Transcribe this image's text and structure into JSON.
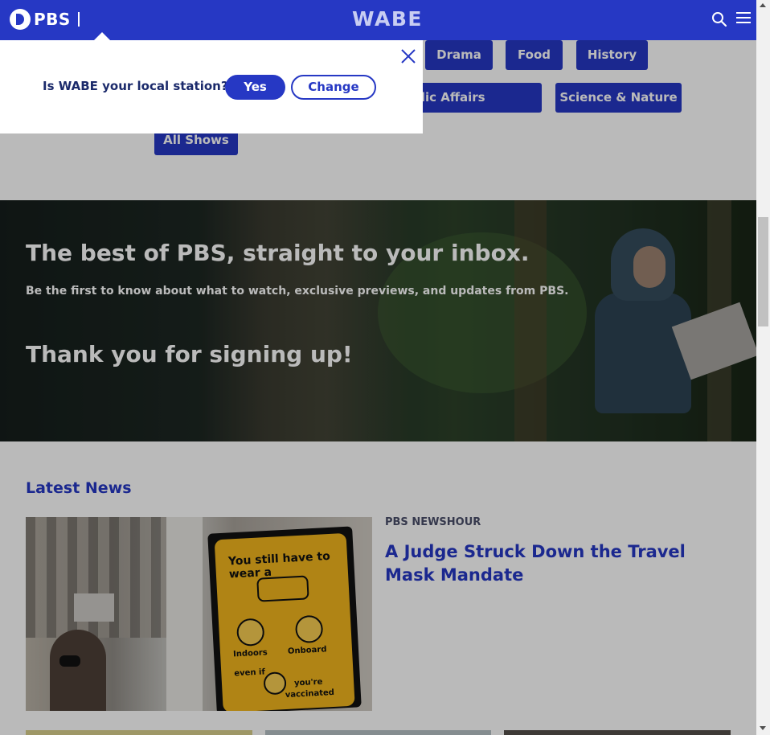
{
  "header": {
    "pbs_logo_text": "PBS",
    "station_logo_text": "WABE",
    "icons": [
      "search-icon",
      "menu-icon"
    ]
  },
  "genres": {
    "items": [
      {
        "label": "Drama"
      },
      {
        "label": "Food"
      },
      {
        "label": "History"
      },
      {
        "label": "News & Public Affairs"
      },
      {
        "label": "Science & Nature"
      },
      {
        "label": "All Shows"
      }
    ]
  },
  "newsletter": {
    "title": "The best of PBS, straight to your inbox.",
    "subtitle": "Be the first to know about what to watch, exclusive previews, and updates from PBS.",
    "confirmation": "Thank you for signing up!"
  },
  "latest_news": {
    "section_title": "Latest News",
    "featured": {
      "source": "PBS NEWSHOUR",
      "headline": "A Judge Struck Down the Travel Mask Mandate",
      "image_sign": {
        "line1": "You still have to",
        "line2": "wear a",
        "label_indoors": "Indoors",
        "label_onboard": "Onboard",
        "label_even_if": "even if",
        "label_youre": "you're",
        "label_vaccinated": "vaccinated"
      }
    }
  },
  "station_popup": {
    "question": "Is WABE your local station?",
    "yes_label": "Yes",
    "change_label": "Change"
  },
  "colors": {
    "brand_blue": "#2638c4",
    "header_blue": "#2638c4",
    "popup_text": "#1b2a6b"
  }
}
